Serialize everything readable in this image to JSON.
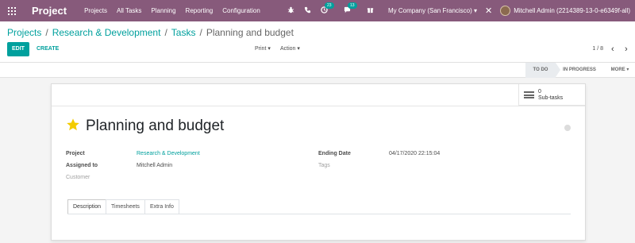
{
  "navbar": {
    "app_name": "Project",
    "menu": [
      "Projects",
      "All Tasks",
      "Planning",
      "Reporting",
      "Configuration"
    ],
    "chat_badge": "23",
    "activity_badge": "13",
    "company": "My Company (San Francisco)",
    "user": "Mitchell Admin (2214389-13-0-e6349f-all)"
  },
  "breadcrumb": {
    "item1": "Projects",
    "item2": "Research & Development",
    "item3": "Tasks",
    "current": "Planning and budget"
  },
  "toolbar": {
    "edit_label": "EDIT",
    "create_label": "CREATE",
    "print_label": "Print",
    "action_label": "Action",
    "pager": "1 / 8"
  },
  "statusbar": {
    "stage_todo": "TO DO",
    "stage_progress": "IN PROGRESS",
    "stage_more": "MORE"
  },
  "form": {
    "subtasks_count": "0",
    "subtasks_label": "Sub-tasks",
    "title": "Planning and budget",
    "project_label": "Project",
    "project_value": "Research & Development",
    "assigned_label": "Assigned to",
    "assigned_value": "Mitchell Admin",
    "customer_label": "Customer",
    "ending_label": "Ending Date",
    "ending_value": "04/17/2020 22:15:04",
    "tags_label": "Tags",
    "tabs": [
      "Description",
      "Timesheets",
      "Extra Info"
    ]
  },
  "colors": {
    "navbar": "#875a7b",
    "accent": "#00a09d",
    "star": "#f3cc00"
  },
  "icons": [
    "apps-grid-icon",
    "bug-icon",
    "phone-icon",
    "chat-icon",
    "clock-activity-icon",
    "gift-icon",
    "close-icon",
    "chevron-left-icon",
    "chevron-right-icon",
    "star-icon",
    "subtasks-icon"
  ]
}
